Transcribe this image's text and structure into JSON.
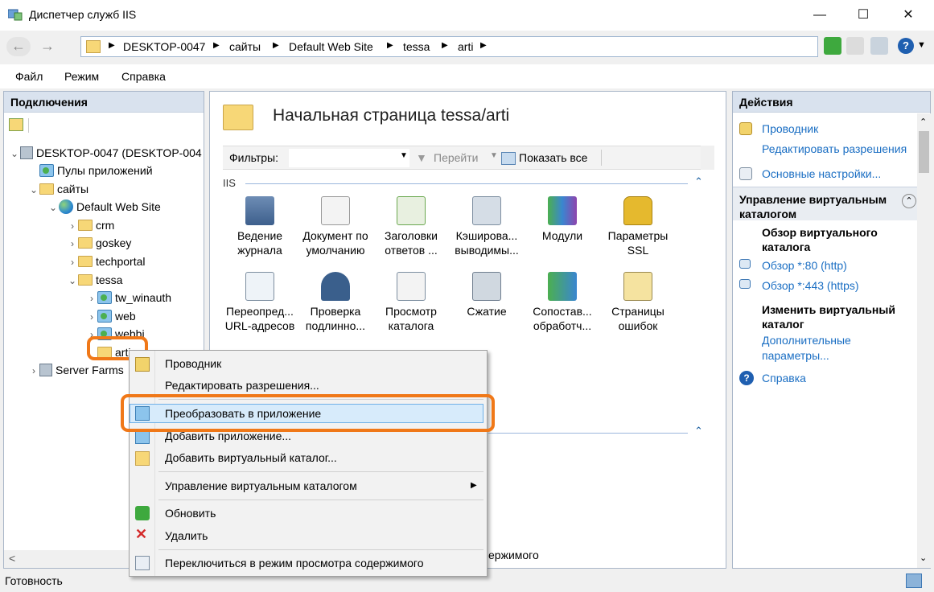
{
  "window": {
    "title": "Диспетчер служб IIS",
    "minimize": "—",
    "maximize": "☐",
    "close": "✕"
  },
  "breadcrumb": [
    "DESKTOP-0047",
    "сайты",
    "Default Web Site",
    "tessa",
    "arti"
  ],
  "menu": [
    "Файл",
    "Режим",
    "Справка"
  ],
  "connections": {
    "title": "Подключения",
    "tree": [
      {
        "label": "DESKTOP-0047 (DESKTOP-004",
        "level": 0,
        "expand": "v",
        "icon": "server"
      },
      {
        "label": "Пулы приложений",
        "level": 1,
        "expand": "",
        "icon": "app"
      },
      {
        "label": "сайты",
        "level": 1,
        "expand": "v",
        "icon": "folder"
      },
      {
        "label": "Default Web Site",
        "level": 2,
        "expand": "v",
        "icon": "globe"
      },
      {
        "label": "crm",
        "level": 3,
        "expand": ">",
        "icon": "folder"
      },
      {
        "label": "goskey",
        "level": 3,
        "expand": ">",
        "icon": "folder"
      },
      {
        "label": "techportal",
        "level": 3,
        "expand": ">",
        "icon": "folder"
      },
      {
        "label": "tessa",
        "level": 3,
        "expand": "v",
        "icon": "folder"
      },
      {
        "label": "tw_winauth",
        "level": 4,
        "expand": ">",
        "icon": "app"
      },
      {
        "label": "web",
        "level": 4,
        "expand": ">",
        "icon": "app"
      },
      {
        "label": "webbi",
        "level": 4,
        "expand": ">",
        "icon": "app"
      },
      {
        "label": "arti",
        "level": 4,
        "expand": "",
        "icon": "folder"
      },
      {
        "label": "Server Farms",
        "level": 0,
        "expand": ">",
        "icon": "server"
      }
    ]
  },
  "center": {
    "title": "Начальная страница tessa/arti",
    "filter_label": "Фильтры:",
    "go": "Перейти",
    "show_all": "Показать все",
    "group": "IIS",
    "features_row1": [
      "Ведение журнала",
      "Документ по умолчанию",
      "Заголовки ответов ...",
      "Кэширова... выводимы...",
      "Модули",
      "Параметры SSL"
    ],
    "features_row2": [
      "Переопред... URL-адресов",
      "Проверка подлинно...",
      "Просмотр каталога",
      "Сжатие",
      "Сопостав... обработч...",
      "Страницы ошибок"
    ],
    "bottom_text": "ержимого"
  },
  "actions": {
    "title": "Действия",
    "explore": "Проводник",
    "edit_permissions": "Редактировать разрешения",
    "basic_settings": "Основные настройки...",
    "vdir_section": "Управление виртуальным каталогом",
    "browse_head": "Обзор виртуального каталога",
    "browse80": "Обзор *:80 (http)",
    "browse443": "Обзор *:443 (https)",
    "edit_head": "Изменить виртуальный каталог",
    "advanced": "Дополнительные параметры...",
    "help": "Справка"
  },
  "context_menu": {
    "items": [
      "Проводник",
      "Редактировать разрешения...",
      "Преобразовать в приложение",
      "Добавить приложение...",
      "Добавить виртуальный каталог...",
      "Управление виртуальным каталогом",
      "Обновить",
      "Удалить",
      "Переключиться в режим просмотра содержимого"
    ]
  },
  "status": "Готовность",
  "colors": {
    "highlight_ring": "#f07818",
    "link": "#1a6ec3",
    "panel_header": "#d9e2ee"
  }
}
